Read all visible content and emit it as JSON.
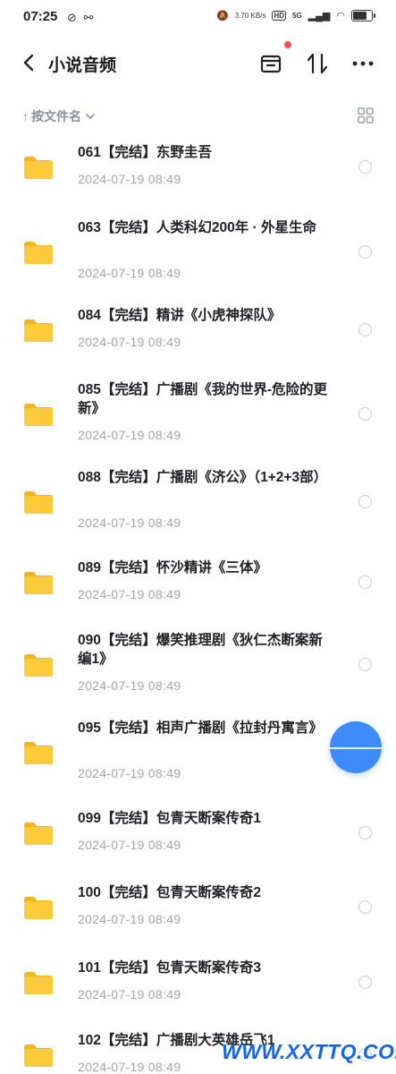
{
  "status_bar": {
    "time": "07:25",
    "net_speed": "3.70 KB/s",
    "hd_badge": "HD",
    "network": "5G",
    "battery_level": 0.7
  },
  "header": {
    "title": "小说音频",
    "back_icon": "chevron-left-icon",
    "inbox_icon": "inbox-icon",
    "sort_icon": "sort-arrows-icon",
    "more_icon": "more-dots-icon",
    "notification_dot_color": "#f0505a"
  },
  "sort_bar": {
    "label": "按文件名",
    "arrow": "↑",
    "view_icon": "grid-view-icon"
  },
  "files": [
    {
      "name": "061【完结】东野圭吾",
      "date": "2024-07-19  08:49"
    },
    {
      "name": "063【完结】人类科幻200年 · 外星生命",
      "date": "2024-07-19  08:49"
    },
    {
      "name": "084【完结】精讲《小虎神探队》",
      "date": "2024-07-19  08:49"
    },
    {
      "name": "085【完结】广播剧《我的世界-危险的更新》",
      "date": "2024-07-19  08:49"
    },
    {
      "name": "088【完结】广播剧《济公》（1+2+3部）",
      "date": "2024-07-19  08:49"
    },
    {
      "name": "089【完结】怀沙精讲《三体》",
      "date": "2024-07-19  08:49"
    },
    {
      "name": "090【完结】爆笑推理剧《狄仁杰断案新编1》",
      "date": "2024-07-19  08:49"
    },
    {
      "name": "095【完结】相声广播剧《拉封丹寓言》",
      "date": "2024-07-19  08:49"
    },
    {
      "name": "099【完结】包青天断案传奇1",
      "date": "2024-07-19  08:49"
    },
    {
      "name": "100【完结】包青天断案传奇2",
      "date": "2024-07-19  08:49"
    },
    {
      "name": "101【完结】包青天断案传奇3",
      "date": "2024-07-19  08:49"
    },
    {
      "name": "102【完结】广播剧大英雄岳飞1",
      "date": "2024-07-19  08:49"
    }
  ],
  "colors": {
    "accent": "#3d8bfd",
    "folder": "#fcc934",
    "date_text": "#a1a4ab"
  },
  "watermark": "WWW.XXTTQ.COM"
}
